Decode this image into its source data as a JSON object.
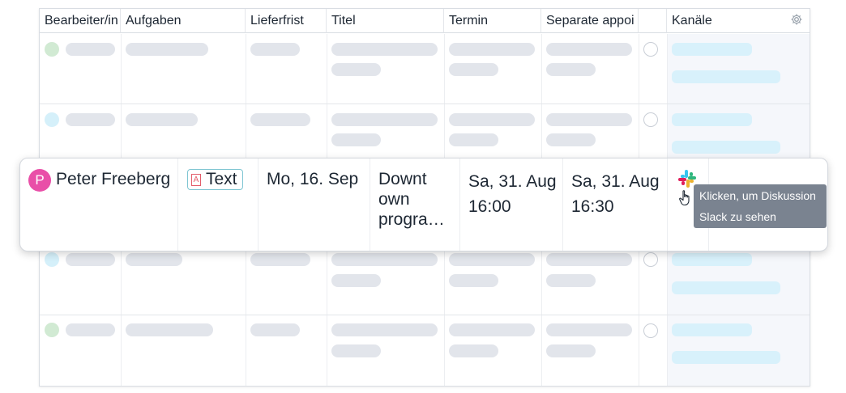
{
  "table": {
    "columns": [
      "Bearbeiter/in",
      "Aufgaben",
      "Lieferfrist",
      "Titel",
      "Termin",
      "Separate appoi",
      "",
      "Kanäle"
    ],
    "settings_icon": "gear-icon"
  },
  "placeholder_rows": [
    {
      "dot_color": "#d1ead3"
    },
    {
      "dot_color": "#d5f0fa"
    },
    {
      "dot_color": "#d5f0fa"
    },
    {
      "dot_color": "#d1ead3"
    }
  ],
  "highlight_row": {
    "avatar_letter": "P",
    "avatar_color": "#e94fa8",
    "assignee": "Peter Freeberg",
    "task_tag": "Text",
    "deadline": "Mo, 16. Sep",
    "title": [
      "Downt",
      "own",
      "progra…"
    ],
    "appointment": [
      "Sa, 31. Aug",
      "16:00"
    ],
    "separate_appointment": [
      "Sa, 31. Aug",
      "16:30"
    ],
    "channel_icon": "slack-icon"
  },
  "tooltip": {
    "line1": "Klicken, um Diskussion",
    "line2": "Slack zu sehen"
  },
  "colors": {
    "placeholder_gray": "#e2e5eb",
    "placeholder_blue": "#d8f1fb",
    "tooltip_bg": "#7a8390"
  }
}
